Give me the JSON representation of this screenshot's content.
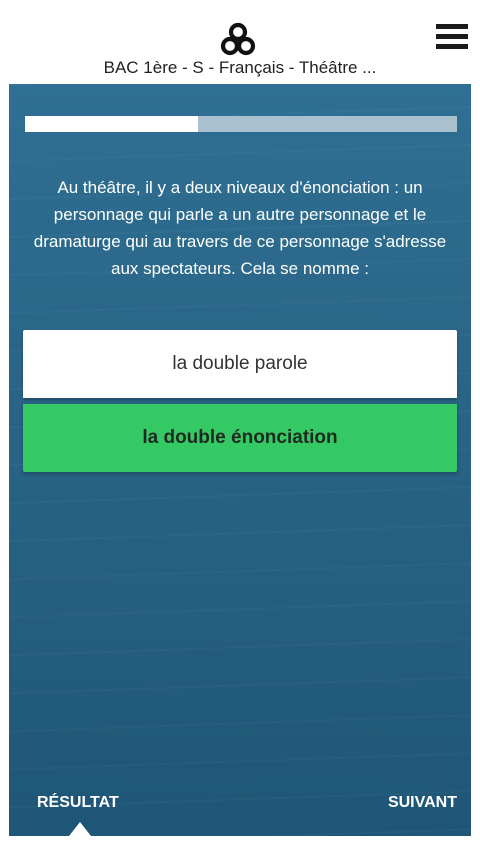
{
  "header": {
    "title": "BAC 1ère - S - Français - Théâtre ...",
    "logo_icon": "trefoil-logo-icon",
    "menu_icon": "hamburger-menu-icon"
  },
  "quiz": {
    "progress": 0.4,
    "question": "Au théâtre, il y a deux niveaux d'énonciation : un personnage qui parle a un autre personnage et le dramaturge qui au travers de ce personnage s'adresse aux spectateurs. Cela se nomme :",
    "answers": [
      {
        "label": "la double parole",
        "state": "default"
      },
      {
        "label": "la double énonciation",
        "state": "correct"
      }
    ]
  },
  "footer": {
    "result_label": "RÉSULTAT",
    "next_label": "SUIVANT"
  },
  "colors": {
    "panel": "#2a6688",
    "correct": "#35c965",
    "track": "#a9c0cf"
  }
}
